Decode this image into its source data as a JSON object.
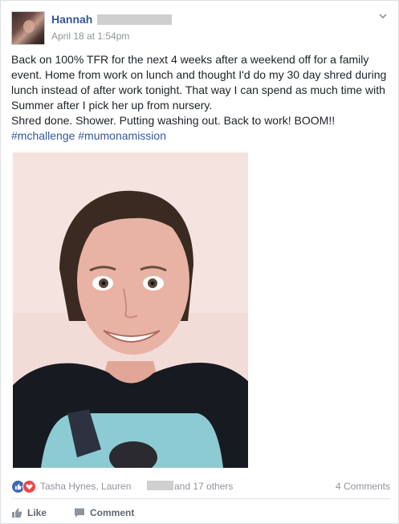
{
  "post": {
    "author": "Hannah",
    "timestamp": "April 18 at 1:54pm",
    "text_lines": [
      "Back on 100% TFR for the next 4 weeks after a weekend off for a family event. Home from work on lunch and thought I'd do my 30 day shred during lunch instead of after work tonight. That way I can spend as much time with Summer after I pick her up from nursery.",
      "Shred done. Shower. Putting washing out. Back to work! BOOM!!"
    ],
    "hashtags": "#mchallenge #mumonamission"
  },
  "reactions": {
    "names": "Tasha Hynes, Lauren",
    "others": "and 17 others",
    "comments": "4 Comments",
    "like_icon": "thumbs-up-icon",
    "love_icon": "heart-icon"
  },
  "actions": {
    "like_label": "Like",
    "comment_label": "Comment"
  },
  "colors": {
    "link_blue": "#365899",
    "like_blue": "#4267b2",
    "love_red": "#e9484d",
    "muted_gray": "#90949c"
  }
}
